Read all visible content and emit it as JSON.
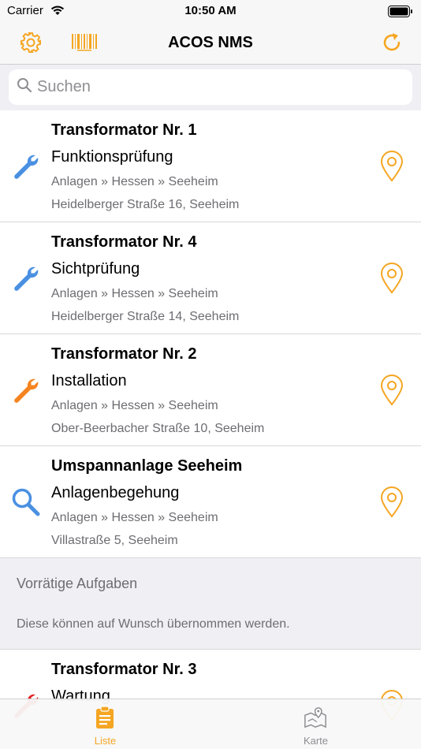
{
  "status_bar": {
    "carrier": "Carrier",
    "time": "10:50 AM"
  },
  "nav": {
    "title": "ACOS NMS"
  },
  "search": {
    "placeholder": "Suchen"
  },
  "colors": {
    "accent": "#f5a623",
    "wrench_blue": "#4a90e2",
    "wrench_orange": "#f5841f",
    "wrench_red": "#e02020"
  },
  "items": [
    {
      "title": "Transformator Nr. 1",
      "task": "Funktionsprüfung",
      "path": "Anlagen » Hessen » Seeheim",
      "address": "Heidelberger Straße 16, Seeheim",
      "icon": "wrench-blue"
    },
    {
      "title": "Transformator Nr. 4",
      "task": "Sichtprüfung",
      "path": "Anlagen » Hessen » Seeheim",
      "address": "Heidelberger Straße 14, Seeheim",
      "icon": "wrench-blue"
    },
    {
      "title": "Transformator Nr. 2",
      "task": "Installation",
      "path": "Anlagen » Hessen » Seeheim",
      "address": "Ober-Beerbacher Straße 10, Seeheim",
      "icon": "wrench-orange"
    },
    {
      "title": "Umspannanlage Seeheim",
      "task": "Anlagenbegehung",
      "path": "Anlagen » Hessen » Seeheim",
      "address": "Villastraße 5, Seeheim",
      "icon": "magnifier-blue"
    }
  ],
  "section": {
    "heading": "Vorrätige Aufgaben",
    "note": "Diese können auf Wunsch übernommen werden."
  },
  "stock_items": [
    {
      "title": "Transformator Nr. 3",
      "task": "Wartung",
      "icon": "wrench-red"
    }
  ],
  "tabs": [
    {
      "label": "Liste",
      "icon": "clipboard-icon",
      "selected": true
    },
    {
      "label": "Karte",
      "icon": "map-icon",
      "selected": false
    }
  ]
}
